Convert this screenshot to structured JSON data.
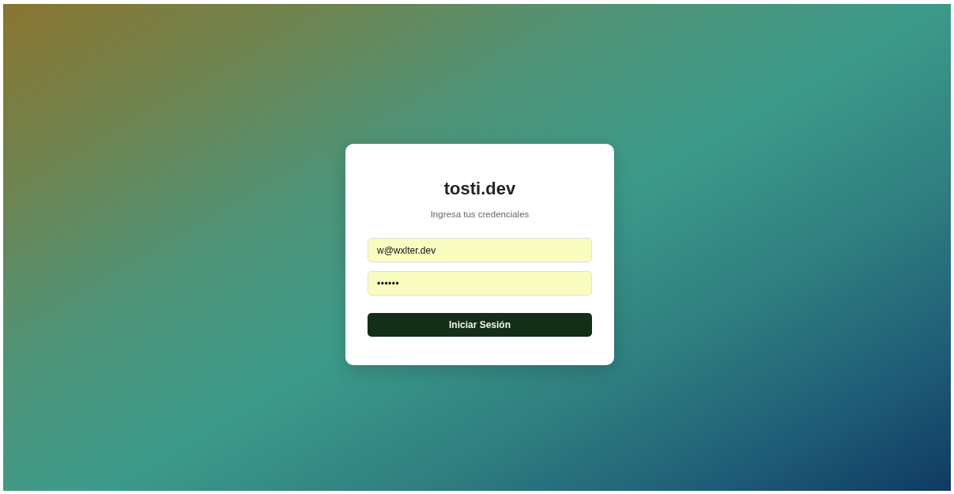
{
  "title": "tosti.dev",
  "subtitle": "Ingresa tus credenciales",
  "fields": [
    {
      "value": "w@wxlter.dev"
    },
    {
      "value": "••••••"
    }
  ],
  "button": "Iniciar Sesión"
}
